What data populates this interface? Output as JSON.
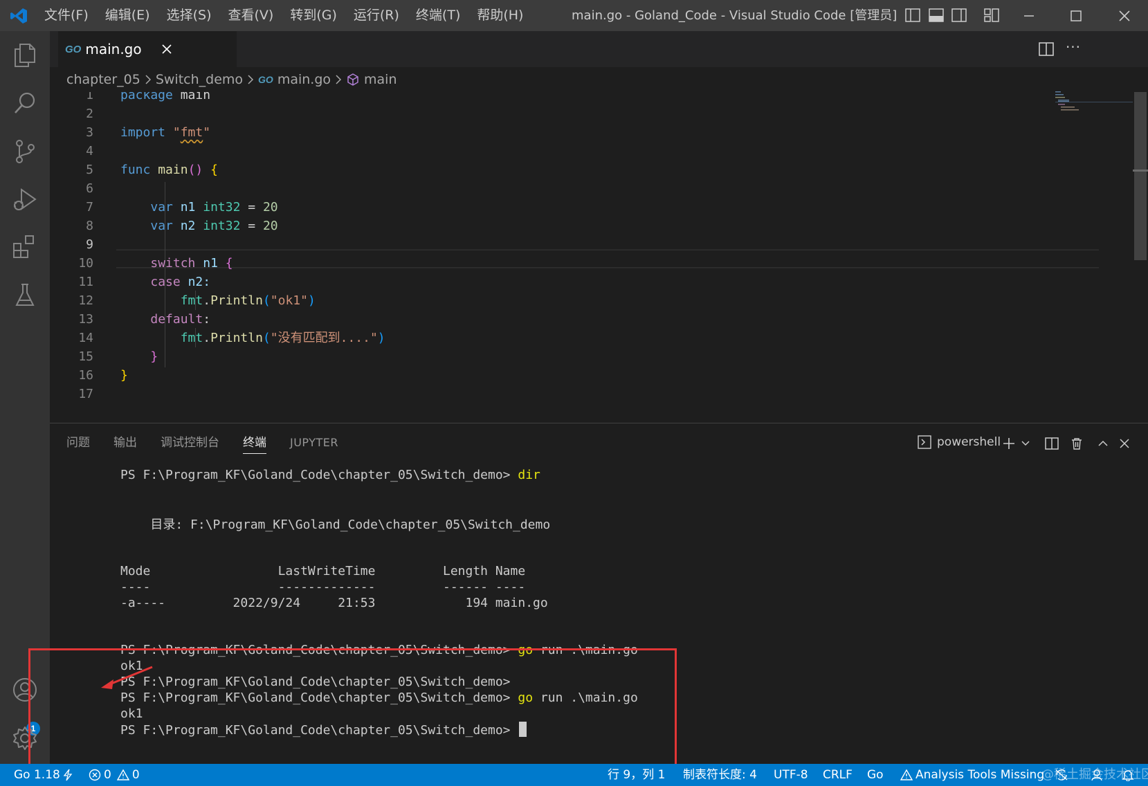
{
  "titlebar": {
    "menu": [
      "文件(F)",
      "编辑(E)",
      "选择(S)",
      "查看(V)",
      "转到(G)",
      "运行(R)",
      "终端(T)",
      "帮助(H)"
    ],
    "window_title": "main.go - Goland_Code - Visual Studio Code [管理员]"
  },
  "tab": {
    "go_badge": "GO",
    "label": "main.go"
  },
  "breadcrumb": {
    "folder1": "chapter_05",
    "folder2": "Switch_demo",
    "file": "main.go",
    "symbol": "main"
  },
  "editor": {
    "active_line": 9,
    "line_numbers": [
      "1",
      "2",
      "3",
      "4",
      "5",
      "6",
      "7",
      "8",
      "9",
      "10",
      "11",
      "12",
      "13",
      "14",
      "15",
      "16",
      "17"
    ],
    "tokens": {
      "package": "package",
      "main_pkg": "main",
      "import": "import",
      "q1": "\"",
      "fmt_str": "fmt",
      "q2": "\"",
      "func": "func",
      "main_fn": "main",
      "paren": "()",
      "brace_open": "{",
      "var1": "var",
      "n1": "n1",
      "int32_1": "int32",
      "eq1": "=",
      "num1": "20",
      "var2": "var",
      "n2": "n2",
      "int32_2": "int32",
      "eq2": "=",
      "num2": "20",
      "switch": "switch",
      "n1b": "n1",
      "sw_open": "{",
      "case": "case",
      "n2b": "n2:",
      "fmt1": "fmt",
      "println1": "Println",
      "p1o": "(",
      "str1": "\"ok1\"",
      "p1c": ")",
      "default": "default",
      "colon": ":",
      "fmt2": "fmt",
      "println2": "Println",
      "p2o": "(",
      "str2": "\"没有匹配到....\"",
      "p2c": ")",
      "sw_close": "}",
      "brace_close": "}"
    }
  },
  "panel": {
    "tabs": [
      "问题",
      "输出",
      "调试控制台",
      "终端",
      "JUPYTER"
    ],
    "active_tab": "终端",
    "terminal_kind": "powershell"
  },
  "terminal": {
    "prompt": "PS F:\\Program_KF\\Goland_Code\\chapter_05\\Switch_demo>",
    "cmd_dir": "dir",
    "dir_line": "    目录: F:\\Program_KF\\Goland_Code\\chapter_05\\Switch_demo",
    "header": "Mode                 LastWriteTime         Length Name",
    "underline": "----                 -------------         ------ ----",
    "row": "-a----         2022/9/24     21:53            194 main.go",
    "cmd_go": "go",
    "cmd_rest": " run .\\main.go",
    "output1": "ok1",
    "output2": "ok1"
  },
  "statusbar": {
    "go_version": "Go 1.18",
    "errors": "0",
    "warnings": "0",
    "cursor_pos": "行 9，列 1",
    "tab_size": "制表符长度: 4",
    "encoding": "UTF-8",
    "eol": "CRLF",
    "language": "Go",
    "analysis": "Analysis Tools Missing",
    "watermark": "@稀土掘金技术社区"
  },
  "colors": {
    "accent": "#007acc",
    "annotation_red": "#e23636"
  }
}
